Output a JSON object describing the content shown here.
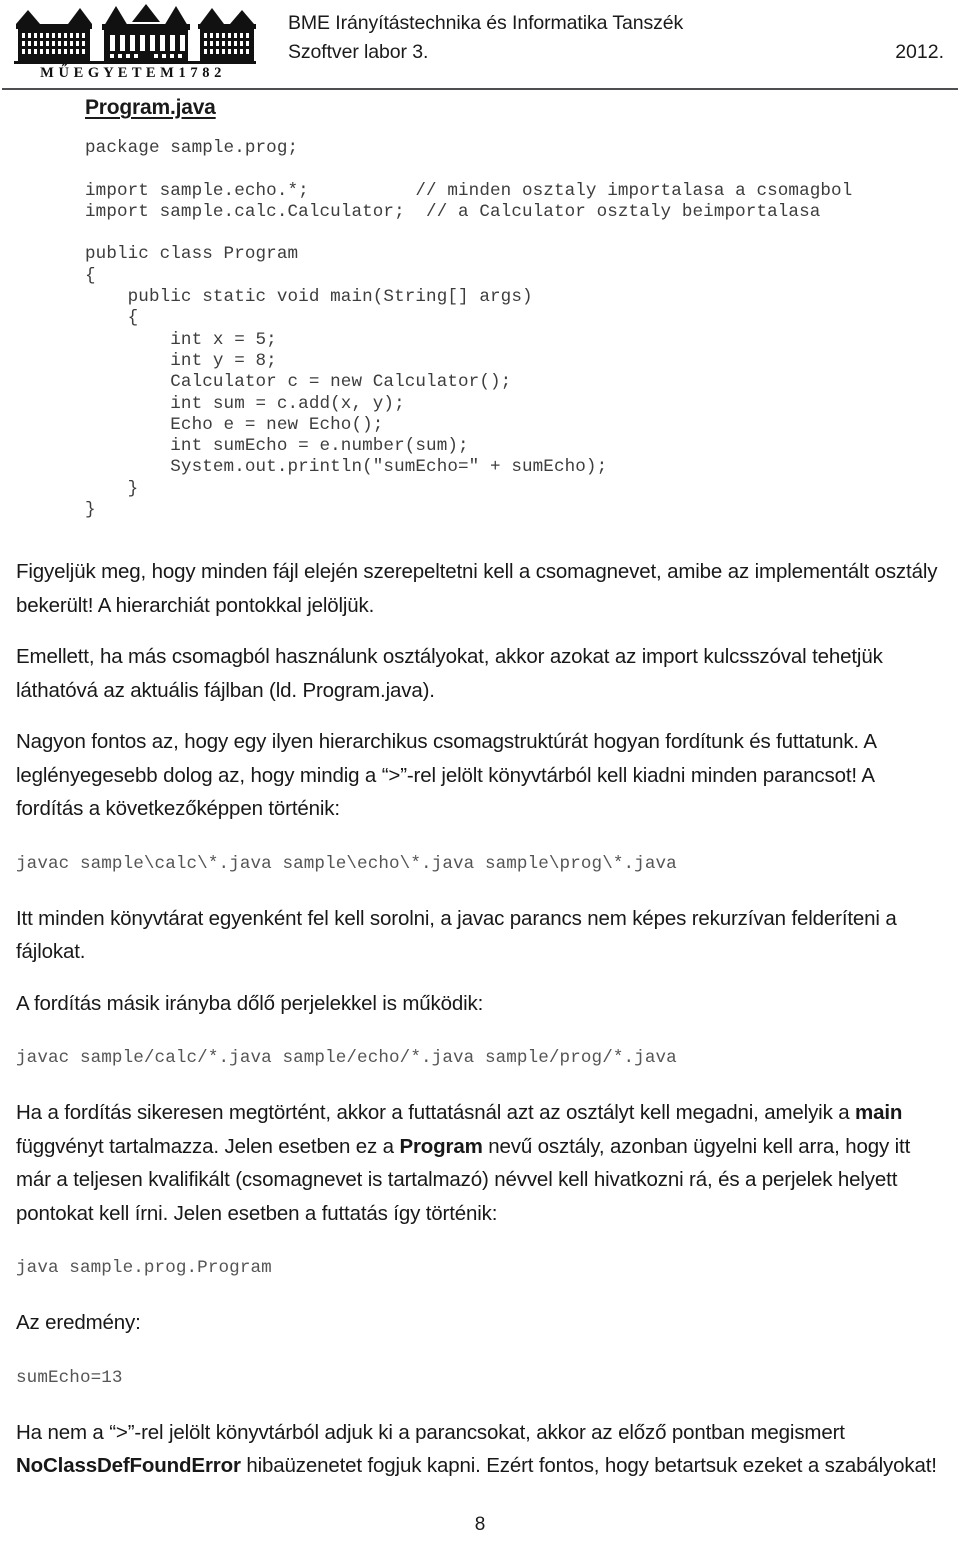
{
  "header": {
    "logo_alt": "bme-muegyetem-logo",
    "logo_caption": "M Ű E G Y E T E M   1 7 8 2",
    "department": "BME Irányítástechnika és Informatika Tanszék",
    "course": "Szoftver labor 3.",
    "year": "2012."
  },
  "code_section": {
    "heading": "Program.java",
    "source": "package sample.prog;\n\nimport sample.echo.*;          // minden osztaly importalasa a csomagbol\nimport sample.calc.Calculator;  // a Calculator osztaly beimportalasa\n\npublic class Program\n{\n    public static void main(String[] args)\n    {\n        int x = 5;\n        int y = 8;\n        Calculator c = new Calculator();\n        int sum = c.add(x, y);\n        Echo e = new Echo();\n        int sumEcho = e.number(sum);\n        System.out.println(\"sumEcho=\" + sumEcho);\n    }\n}"
  },
  "paragraphs": {
    "p1": "Figyeljük meg, hogy minden fájl elején szerepeltetni kell a csomagnevet, amibe az implementált osztály bekerült! A hierarchiát pontokkal jelöljük.",
    "p2": "Emellett, ha más csomagból használunk osztályokat, akkor azokat az import kulcsszóval tehetjük láthatóvá az aktuális fájlban (ld. Program.java).",
    "p3": "Nagyon fontos az, hogy egy ilyen hierarchikus csomagstruktúrát hogyan fordítunk és futtatunk. A leglényegesebb dolog az, hogy mindig a “>”-rel jelölt könyvtárból kell kiadni minden parancsot! A fordítás a következőképpen történik:",
    "p4": "Itt minden könyvtárat egyenként fel kell sorolni, a javac parancs nem képes rekurzívan felderíteni a fájlokat.",
    "p5": "A fordítás másik irányba dőlő perjelekkel is működik:",
    "p6_part1": "Ha a fordítás sikeresen megtörtént, akkor a futtatásnál azt az osztályt kell megadni, amelyik a ",
    "p6_bold1": "main",
    "p6_part2": " függvényt tartalmazza. Jelen esetben ez a ",
    "p6_bold2": "Program",
    "p6_part3": " nevű osztály, azonban ügyelni kell arra, hogy itt már a teljesen kvalifikált (csomagnevet is tartalmazó) névvel kell hivatkozni rá, és a perjelek helyett pontokat kell írni. Jelen esetben a futtatás így történik:",
    "p7_label": "Az eredmény:",
    "p8_part1": "Ha nem a “>”-rel jelölt könyvtárból adjuk ki a parancsokat, akkor az előző pontban megismert ",
    "p8_bold1": "NoClassDefFoundError",
    "p8_part2": " hibaüzenetet fogjuk kapni. Ezért fontos, hogy betartsuk ezeket a szabályokat!"
  },
  "commands": {
    "compile_backslash": "javac sample\\calc\\*.java sample\\echo\\*.java sample\\prog\\*.java",
    "compile_forwardslash": "javac sample/calc/*.java sample/echo/*.java sample/prog/*.java",
    "run": "java sample.prog.Program",
    "output": "sumEcho=13"
  },
  "footer": {
    "page_number": "8"
  },
  "colors": {
    "text": "#181818",
    "code": "#3d3d3d",
    "rule": "#4d4f52"
  }
}
